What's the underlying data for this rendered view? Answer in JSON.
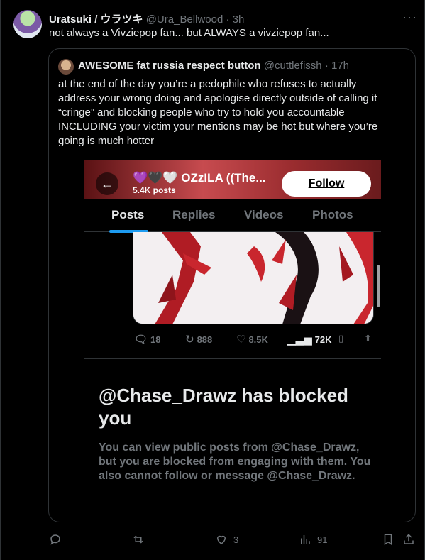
{
  "tweet": {
    "display_name": "Uratsuki / ウラツキ",
    "handle": "@Ura_Bellwood",
    "time": "· 3h",
    "more_label": "···",
    "text": "not always a Vivziepop fan... but ALWAYS a vivziepop fan..."
  },
  "quote": {
    "display_name": "AWESOME fat russia respect button",
    "handle": "@cuttlefissh",
    "time": "· 17h",
    "text": "at the end of the day you’re a pedophile who refuses to actually\naddress your wrong doing and apologise directly outside of calling it\n“cringe” and blocking people who try to hold you accountable\nINCLUDING your victim your mentions may be hot but where you’re\ngoing is much hotter"
  },
  "screenshot": {
    "profile_name": "💜🖤🤍 OZzILA ((The...",
    "post_count": "5.4K posts",
    "follow_label": "Follow",
    "tabs": [
      "Posts",
      "Replies",
      "Videos",
      "Photos"
    ],
    "active_tab": "Posts",
    "embed_actions": {
      "replies": "18",
      "reposts": "888",
      "likes": "8.5K",
      "views": "72K"
    },
    "blocked_title": "@Chase_Drawz has blocked you",
    "blocked_desc": "You can view public posts from @Chase_Drawz, but you are blocked from engaging with them. You also cannot follow or message @Chase_Drawz."
  },
  "actions": {
    "replies": "",
    "reposts": "",
    "likes": "3",
    "views": "91"
  },
  "colors": {
    "background": "#000000",
    "text": "#e7e9ea",
    "muted": "#71767b",
    "border": "#2f3336",
    "accent": "#1d9bf0"
  }
}
